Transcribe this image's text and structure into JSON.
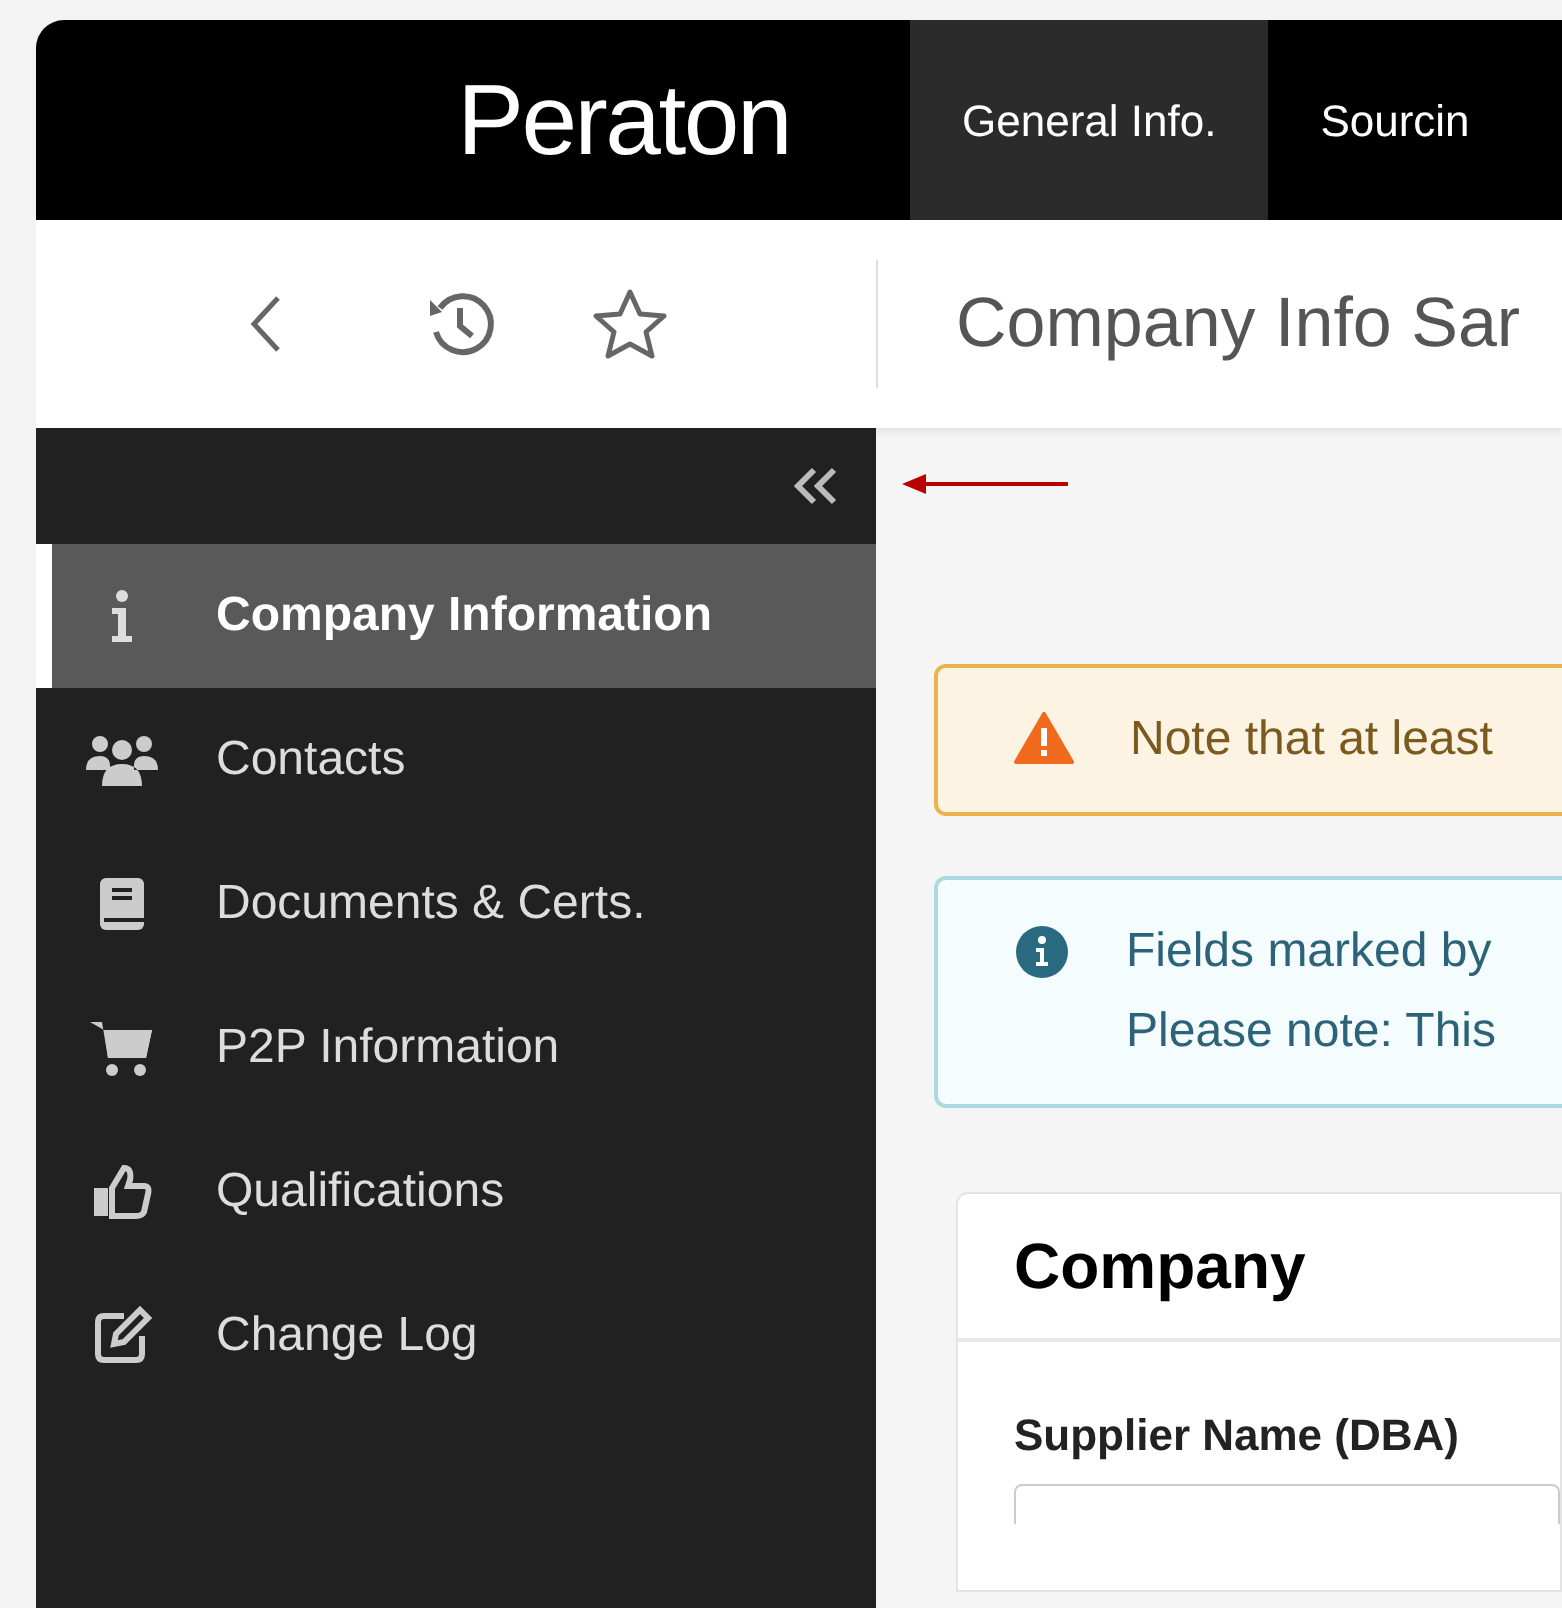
{
  "brand": {
    "logo": "Peraton"
  },
  "top_tabs": [
    {
      "label": "General Info.",
      "selected": true
    },
    {
      "label": "Sourcin",
      "selected": false
    }
  ],
  "page_title": "Company Info Sar",
  "sidebar": {
    "items": [
      {
        "label": "Company Information",
        "kind": "info",
        "selected": true
      },
      {
        "label": "Contacts",
        "kind": "users",
        "selected": false
      },
      {
        "label": "Documents & Certs.",
        "kind": "book",
        "selected": false
      },
      {
        "label": "P2P Information",
        "kind": "cart",
        "selected": false
      },
      {
        "label": "Qualifications",
        "kind": "thumb",
        "selected": false
      },
      {
        "label": "Change Log",
        "kind": "edit",
        "selected": false
      }
    ]
  },
  "alerts": [
    {
      "kind": "warning",
      "lines": [
        "Note that at least"
      ]
    },
    {
      "kind": "info",
      "lines": [
        "Fields marked by",
        "Please note: This"
      ]
    }
  ],
  "card": {
    "title": "Company",
    "field_label": "Supplier Name (DBA)"
  }
}
